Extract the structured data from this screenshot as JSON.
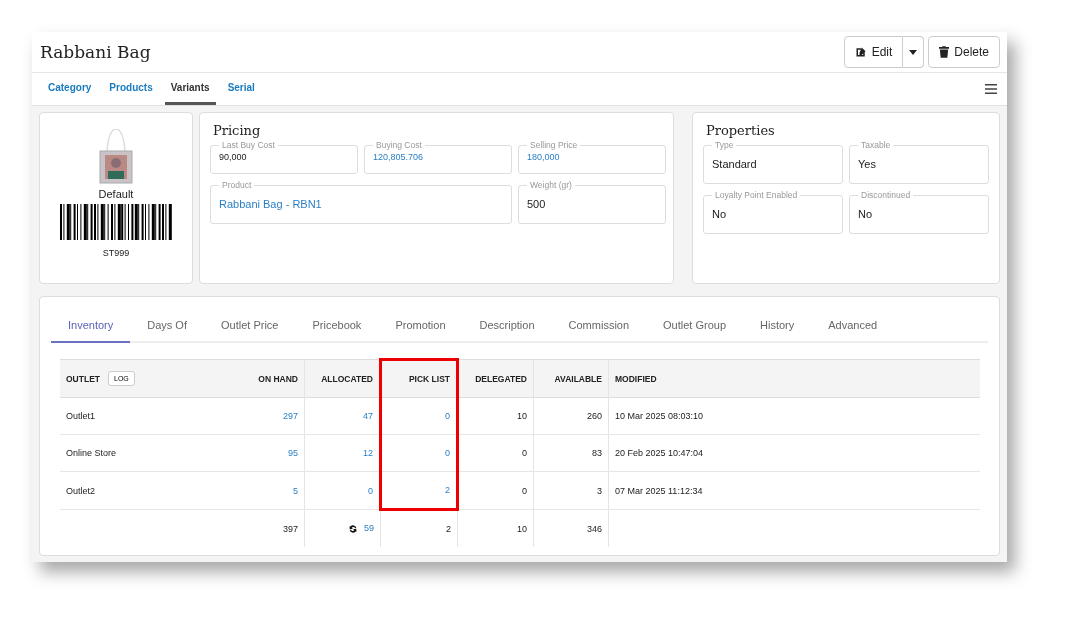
{
  "title": "Rabbani Bag",
  "actions": {
    "edit": "Edit",
    "delete": "Delete"
  },
  "nav_tabs": [
    {
      "label": "Category",
      "selected": false
    },
    {
      "label": "Products",
      "selected": false
    },
    {
      "label": "Variants",
      "selected": true
    },
    {
      "label": "Serial",
      "selected": false
    }
  ],
  "variant": {
    "name": "Default",
    "code": "ST999"
  },
  "pricing": {
    "title": "Pricing",
    "fields": [
      {
        "label": "Last Buy Cost",
        "value": "90,000",
        "link": false
      },
      {
        "label": "Buying Cost",
        "value": "120,805.706",
        "link": true
      },
      {
        "label": "Selling Price",
        "value": "180,000",
        "link": true
      },
      {
        "label": "Product",
        "value": "Rabbani Bag - RBN1",
        "link": true
      },
      {
        "label": "Weight (gr)",
        "value": "500",
        "link": false
      }
    ]
  },
  "properties": {
    "title": "Properties",
    "fields": [
      {
        "label": "Type",
        "value": "Standard"
      },
      {
        "label": "Taxable",
        "value": "Yes"
      },
      {
        "label": "Loyalty Point Enabled",
        "value": "No"
      },
      {
        "label": "Discontinued",
        "value": "No"
      }
    ]
  },
  "detail_tabs": [
    {
      "label": "Inventory",
      "selected": true
    },
    {
      "label": "Days Of",
      "selected": false
    },
    {
      "label": "Outlet Price",
      "selected": false
    },
    {
      "label": "Pricebook",
      "selected": false
    },
    {
      "label": "Promotion",
      "selected": false
    },
    {
      "label": "Description",
      "selected": false
    },
    {
      "label": "Commission",
      "selected": false
    },
    {
      "label": "Outlet Group",
      "selected": false
    },
    {
      "label": "History",
      "selected": false
    },
    {
      "label": "Advanced",
      "selected": false
    }
  ],
  "table": {
    "log_button": "LOG",
    "columns": [
      {
        "label": "OUTLET",
        "highlighted": false
      },
      {
        "label": "ON HAND",
        "highlighted": false
      },
      {
        "label": "ALLOCATED",
        "highlighted": false
      },
      {
        "label": "PICK LIST",
        "highlighted": true
      },
      {
        "label": "DELEGATED",
        "highlighted": false
      },
      {
        "label": "AVAILABLE",
        "highlighted": false
      },
      {
        "label": "MODIFIED",
        "highlighted": false
      }
    ],
    "rows": [
      [
        {
          "text": "Outlet1",
          "link": false
        },
        {
          "text": "297",
          "link": true
        },
        {
          "text": "47",
          "link": true
        },
        {
          "text": "0",
          "link": true
        },
        {
          "text": "10",
          "link": false
        },
        {
          "text": "260",
          "link": false
        },
        {
          "text": "10 Mar 2025 08:03:10",
          "link": false
        }
      ],
      [
        {
          "text": "Online Store",
          "link": false
        },
        {
          "text": "95",
          "link": true
        },
        {
          "text": "12",
          "link": true
        },
        {
          "text": "0",
          "link": true
        },
        {
          "text": "0",
          "link": false
        },
        {
          "text": "83",
          "link": false
        },
        {
          "text": "20 Feb 2025 10:47:04",
          "link": false
        }
      ],
      [
        {
          "text": "Outlet2",
          "link": false
        },
        {
          "text": "5",
          "link": true
        },
        {
          "text": "0",
          "link": true
        },
        {
          "text": "2",
          "link": true
        },
        {
          "text": "0",
          "link": false
        },
        {
          "text": "3",
          "link": false
        },
        {
          "text": "07 Mar 2025 11:12:34",
          "link": false
        }
      ]
    ],
    "totals": [
      {
        "text": "397",
        "link": false,
        "refresh": false
      },
      {
        "text": "59",
        "link": true,
        "refresh": true
      },
      {
        "text": "2",
        "link": false,
        "refresh": false
      },
      {
        "text": "10",
        "link": false,
        "refresh": false
      },
      {
        "text": "346",
        "link": false,
        "refresh": false
      }
    ]
  }
}
